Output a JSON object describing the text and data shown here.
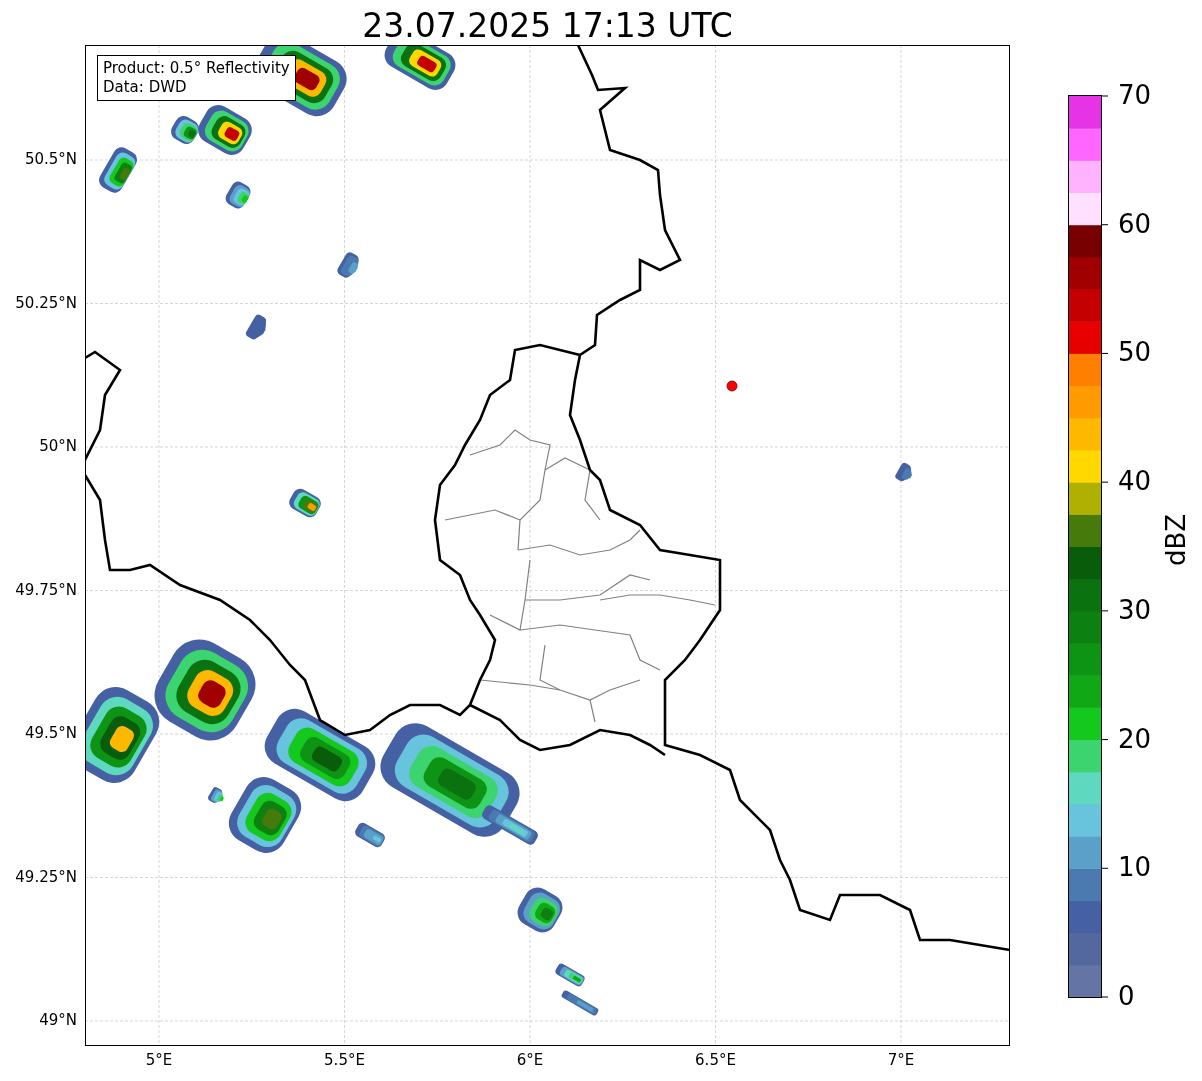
{
  "title": "23.07.2025 17:13 UTC",
  "legend": [
    "Product: 0.5° Reflectivity",
    "Data: DWD"
  ],
  "y_ticks": [
    "50.5°N",
    "50.25°N",
    "50°N",
    "49.75°N",
    "49.5°N",
    "49.25°N",
    "49°N"
  ],
  "x_ticks": [
    "5°E",
    "5.5°E",
    "6°E",
    "6.5°E",
    "7°E"
  ],
  "colorbar": {
    "label": "dBZ",
    "ticks": [
      "70",
      "60",
      "50",
      "40",
      "30",
      "20",
      "10",
      "0"
    ],
    "bands": [
      {
        "color": "#6475a5"
      },
      {
        "color": "#5468a0"
      },
      {
        "color": "#4560a3"
      },
      {
        "color": "#4a7ab0"
      },
      {
        "color": "#5aa0c8"
      },
      {
        "color": "#68c4dc"
      },
      {
        "color": "#5fd8c0"
      },
      {
        "color": "#3cd46e"
      },
      {
        "color": "#14c81e"
      },
      {
        "color": "#10a814"
      },
      {
        "color": "#0e9414"
      },
      {
        "color": "#0c8010"
      },
      {
        "color": "#0a720e"
      },
      {
        "color": "#085c0a"
      },
      {
        "color": "#467a0a"
      },
      {
        "color": "#b0b000"
      },
      {
        "color": "#ffd800"
      },
      {
        "color": "#ffb800"
      },
      {
        "color": "#ff9a00"
      },
      {
        "color": "#ff8000"
      },
      {
        "color": "#e60000"
      },
      {
        "color": "#c40000"
      },
      {
        "color": "#a00000"
      },
      {
        "color": "#780000"
      },
      {
        "color": "#ffe0ff"
      },
      {
        "color": "#ffb3ff"
      },
      {
        "color": "#ff66ff"
      },
      {
        "color": "#e633e6"
      }
    ]
  }
}
